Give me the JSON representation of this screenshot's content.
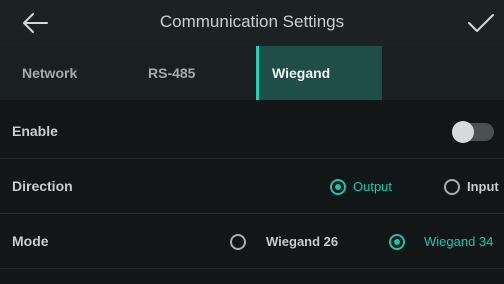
{
  "header": {
    "title": "Communication Settings",
    "back_icon": "arrow-left-icon",
    "confirm_icon": "checkmark-icon"
  },
  "tabs": [
    {
      "label": "Network",
      "active": false
    },
    {
      "label": "RS-485",
      "active": false
    },
    {
      "label": "Wiegand",
      "active": true
    }
  ],
  "enable": {
    "label": "Enable",
    "value": false
  },
  "direction": {
    "label": "Direction",
    "options": [
      {
        "label": "Output",
        "selected": true
      },
      {
        "label": "Input",
        "selected": false
      }
    ]
  },
  "mode": {
    "label": "Mode",
    "options": [
      {
        "label": "Wiegand 26",
        "selected": false
      },
      {
        "label": "Wiegand 34",
        "selected": true
      }
    ]
  },
  "colors": {
    "accent": "#16c9ab",
    "active_tab_bg": "#1f4d47",
    "background": "#121617"
  }
}
